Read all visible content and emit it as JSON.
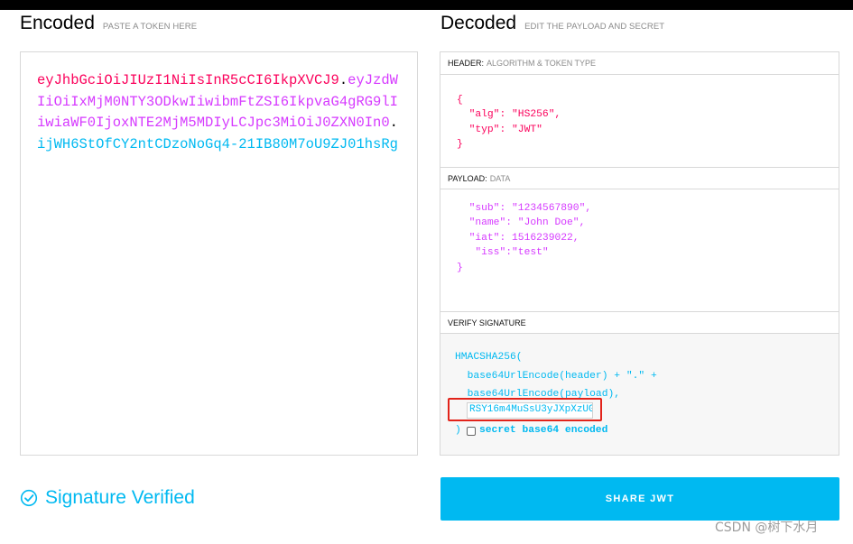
{
  "encoded": {
    "title": "Encoded",
    "subtitle": "PASTE A TOKEN HERE",
    "token_header": "eyJhbGciOiJIUzI1NiIsInR5cCI6IkpXVCJ9",
    "token_payload": "eyJzdWIiOiIxMjM0NTY3ODkwIiwibmFtZSI6IkpvaG4gRG9lIiwiaWF0IjoxNTE2MjM5MDIyLCJpc3MiOiJ0ZXN0In0",
    "token_signature": "ijWH6StOfCY2ntCDzoNoGq4-21IB80M7oU9ZJ01hsRg",
    "separator": "."
  },
  "decoded": {
    "title": "Decoded",
    "subtitle": "EDIT THE PAYLOAD AND SECRET",
    "header": {
      "title": "HEADER:",
      "subtitle": "ALGORITHM & TOKEN TYPE",
      "line_open": "{",
      "alg_key": "\"alg\"",
      "alg_value": "\"HS256\",",
      "typ_key": "\"typ\"",
      "typ_value": "\"JWT\"",
      "line_close": "}"
    },
    "payload": {
      "title": "PAYLOAD:",
      "subtitle": "DATA",
      "sub_line": "\"sub\": \"1234567890\",",
      "name_line": "\"name\": \"John Doe\",",
      "iat_line": "\"iat\": 1516239022,",
      "iss_line": "\"iss\":\"test\"",
      "line_close": "}"
    },
    "verify": {
      "title": "VERIFY SIGNATURE",
      "line1": "HMACSHA256(",
      "line2": "base64UrlEncode(header) + \".\" +",
      "line3": "base64UrlEncode(payload),",
      "secret_value": "RSY16m4MuSsU3yJXpXzUGi",
      "close_paren": ")",
      "checkbox_label": "secret base64 encoded"
    }
  },
  "status": {
    "verified_text": "Signature Verified"
  },
  "share_button": "SHARE JWT",
  "watermark": "CSDN @树下水月",
  "colors": {
    "header": "#fb015b",
    "payload": "#d63aff",
    "signature": "#00b9f1"
  }
}
